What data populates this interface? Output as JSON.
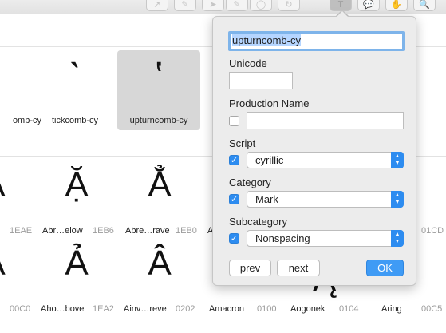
{
  "toolbar": {
    "tools": [
      {
        "name": "select-tool-icon",
        "glyph": "➚"
      },
      {
        "name": "pen-tool-icon",
        "glyph": "✎"
      },
      {
        "name": "draw-tool-icon",
        "glyph": "➤"
      },
      {
        "name": "pencil-tool-icon",
        "glyph": "✎"
      },
      {
        "name": "shape-tool-icon",
        "glyph": "◯"
      },
      {
        "name": "rotate-tool-icon",
        "glyph": "↻"
      },
      {
        "name": "text-tool-icon",
        "glyph": "T"
      },
      {
        "name": "annotation-tool-icon",
        "glyph": "💬"
      },
      {
        "name": "hand-tool-icon",
        "glyph": "✋"
      },
      {
        "name": "zoom-tool-icon",
        "glyph": "🔍"
      }
    ]
  },
  "grid": {
    "row1": [
      {
        "glyph": "",
        "label": "omb-cy"
      },
      {
        "glyph": "ˋ",
        "label": "tickcomb-cy"
      },
      {
        "glyph": "ʽ",
        "label": "upturncomb-cy"
      }
    ],
    "row2": [
      {
        "glyph": "Ậ",
        "label": "",
        "hex": "1EAE"
      },
      {
        "glyph": "Ặ",
        "label": "Abr…elow",
        "hex": "1EB6"
      },
      {
        "glyph": "Ẳ",
        "label": "Abre…rave",
        "hex": "1EB0"
      },
      {
        "glyph": "",
        "label": "A",
        "hex": ""
      }
    ],
    "row2_right_hex": "01CD",
    "row3": [
      {
        "glyph": "Ả",
        "label": "",
        "hex": "00C0"
      },
      {
        "glyph": "Ả",
        "label": "Aho…bove",
        "hex": "1EA2"
      },
      {
        "glyph": "Â",
        "label": "Ainv…reve",
        "hex": "0202"
      },
      {
        "glyph": "",
        "label": "Amacron",
        "hex": "0100"
      },
      {
        "glyph": "",
        "label": "Aogonek",
        "hex": "0104"
      },
      {
        "glyph": "",
        "label": "Aring",
        "hex": "00C5"
      }
    ]
  },
  "popover": {
    "glyph_name": "upturncomb-cy",
    "unicode_label": "Unicode",
    "unicode_value": "",
    "production_label": "Production Name",
    "production_value": "",
    "script_label": "Script",
    "script_value": "cyrillic",
    "category_label": "Category",
    "category_value": "Mark",
    "subcategory_label": "Subcategory",
    "subcategory_value": "Nonspacing",
    "prev_label": "prev",
    "next_label": "next",
    "ok_label": "OK"
  },
  "colors": {
    "accent": "#2d8cf0",
    "selection": "#b5d5ff",
    "popover_bg": "#ececec"
  }
}
